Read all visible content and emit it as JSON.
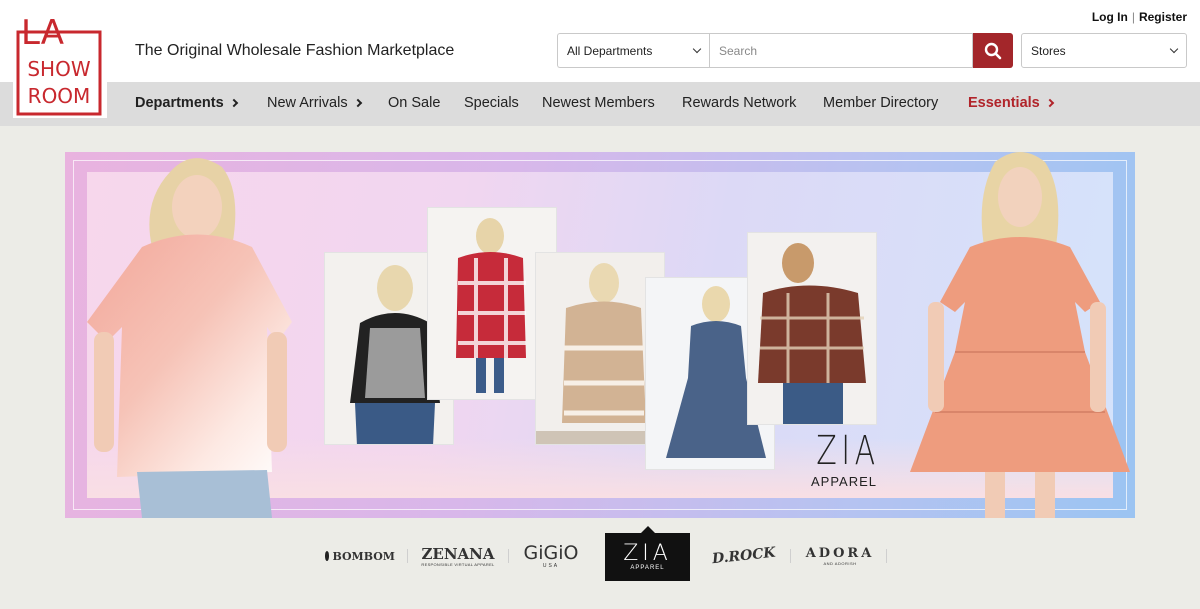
{
  "logo": {
    "line1": "LA",
    "line2": "SHOW",
    "line3": "ROOM",
    "color": "#c8282e"
  },
  "header": {
    "tagline": "The Original Wholesale Fashion Marketplace",
    "login": "Log In",
    "separator": "|",
    "register": "Register",
    "department_select": "All Departments",
    "search_placeholder": "Search",
    "stores_select": "Stores",
    "accent_color": "#a3262a"
  },
  "nav": {
    "items": [
      {
        "label": "Departments"
      },
      {
        "label": "New Arrivals"
      },
      {
        "label": "On Sale"
      },
      {
        "label": "Specials"
      },
      {
        "label": "Newest Members"
      },
      {
        "label": "Rewards Network"
      },
      {
        "label": "Member Directory"
      },
      {
        "label": "Essentials"
      }
    ]
  },
  "banner": {
    "brand_name": "ZIA",
    "brand_sub": "APPAREL"
  },
  "brands": {
    "items": [
      {
        "name": "BOMBOM"
      },
      {
        "name": "ZENANA",
        "sub": "RESPONSIBLE VIRTUAL APPAREL"
      },
      {
        "name": "GiGiO",
        "sub": "USA"
      },
      {
        "name": "ZIA",
        "sub": "APPAREL"
      },
      {
        "name": "D.ROCK"
      },
      {
        "name": "ADORA",
        "sub": "AND ADORISH"
      }
    ]
  }
}
